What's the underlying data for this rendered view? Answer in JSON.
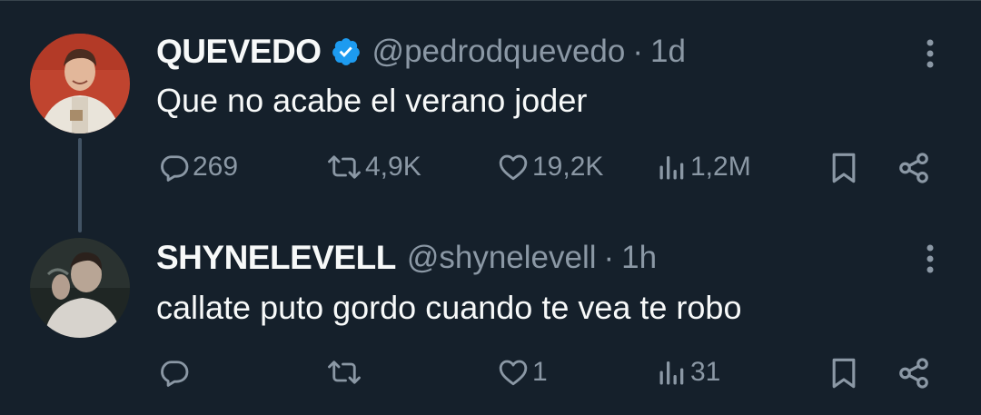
{
  "tweets": [
    {
      "display_name": "QUEVEDO",
      "verified": true,
      "handle": "@pedrodquevedo",
      "separator": "·",
      "time": "1d",
      "text": "Que no acabe el verano joder",
      "actions": {
        "replies": "269",
        "retweets": "4,9K",
        "likes": "19,2K",
        "views": "1,2M"
      }
    },
    {
      "display_name": "SHYNELEVELL",
      "verified": false,
      "handle": "@shynelevell",
      "separator": "·",
      "time": "1h",
      "text": "callate puto gordo cuando te vea te robo",
      "actions": {
        "replies": "",
        "retweets": "",
        "likes": "1",
        "views": "31"
      }
    }
  ],
  "colors": {
    "background": "#15202b",
    "text_primary": "#f7f9f9",
    "text_secondary": "#8b98a5",
    "verified_blue": "#1d9bf0",
    "thread_line": "#425364"
  },
  "icons": [
    "reply-icon",
    "retweet-icon",
    "like-icon",
    "views-icon",
    "bookmark-icon",
    "share-icon",
    "more-icon",
    "verified-badge-icon"
  ]
}
